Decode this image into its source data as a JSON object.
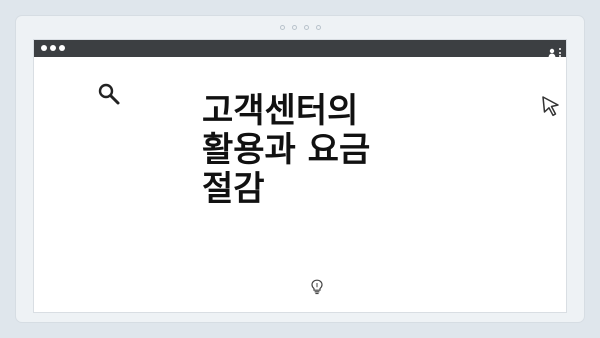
{
  "headline": {
    "line1": "고객센터의",
    "line2": "활용과 요금",
    "line3": "절감"
  },
  "icons": {
    "search": "search-icon",
    "cursor": "cursor-pointer-icon",
    "idea": "lightbulb-icon",
    "user": "user-icon",
    "menu": "kebab-menu-icon"
  },
  "colors": {
    "background": "#dfe6ec",
    "frame": "#eef2f5",
    "titlebar": "#3c3f42",
    "text": "#111111"
  }
}
